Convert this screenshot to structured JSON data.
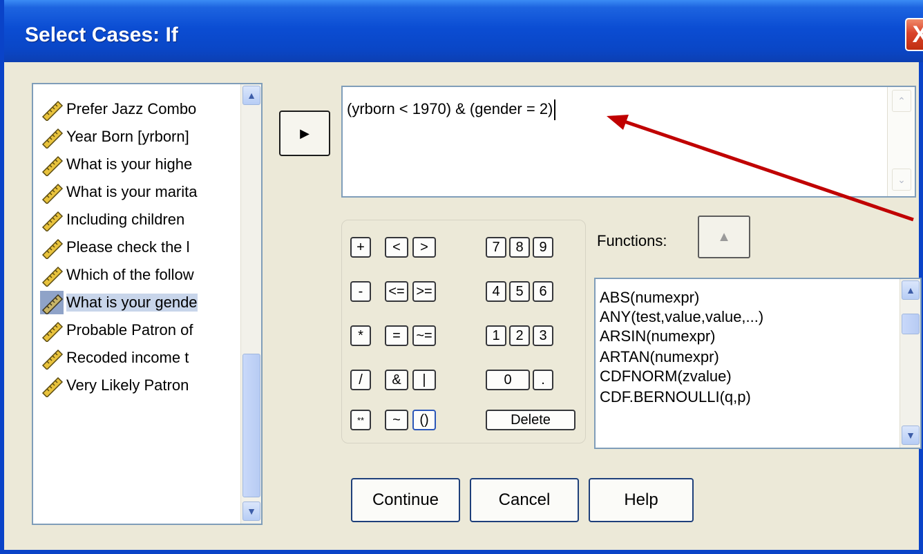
{
  "window": {
    "title": "Select Cases: If",
    "close_symbol": "X"
  },
  "variables": {
    "items": [
      {
        "label": "Prefer Jazz Combo"
      },
      {
        "label": "Year Born [yrborn]"
      },
      {
        "label": "What is your highe"
      },
      {
        "label": "What is your marita"
      },
      {
        "label": "Including children"
      },
      {
        "label": "Please check the l"
      },
      {
        "label": "Which of the follow"
      },
      {
        "label": "What is your gende",
        "selected": true
      },
      {
        "label": "Probable Patron of"
      },
      {
        "label": "Recoded income t"
      },
      {
        "label": "Very Likely Patron"
      }
    ],
    "icon": "ruler-icon"
  },
  "expression": {
    "value": "(yrborn < 1970) & (gender = 2)"
  },
  "keypad": {
    "keys": [
      "+",
      "<",
      ">",
      "7",
      "8",
      "9",
      "-",
      "<=",
      ">=",
      "4",
      "5",
      "6",
      "*",
      "=",
      "~=",
      "1",
      "2",
      "3",
      "/",
      "&",
      "|",
      "0",
      ".",
      "**",
      "~",
      "()",
      "Delete"
    ]
  },
  "functions": {
    "label": "Functions:",
    "items": [
      "ABS(numexpr)",
      "ANY(test,value,value,...)",
      "ARSIN(numexpr)",
      "ARTAN(numexpr)",
      "CDFNORM(zvalue)",
      "CDF.BERNOULLI(q,p)"
    ]
  },
  "buttons": {
    "continue": "Continue",
    "cancel": "Cancel",
    "help": "Help"
  },
  "colors": {
    "title_bar": "#0a46c6",
    "dialog_bg": "#ece9d8",
    "annotation_arrow": "#c00000",
    "selection": "#c8d5ea"
  }
}
